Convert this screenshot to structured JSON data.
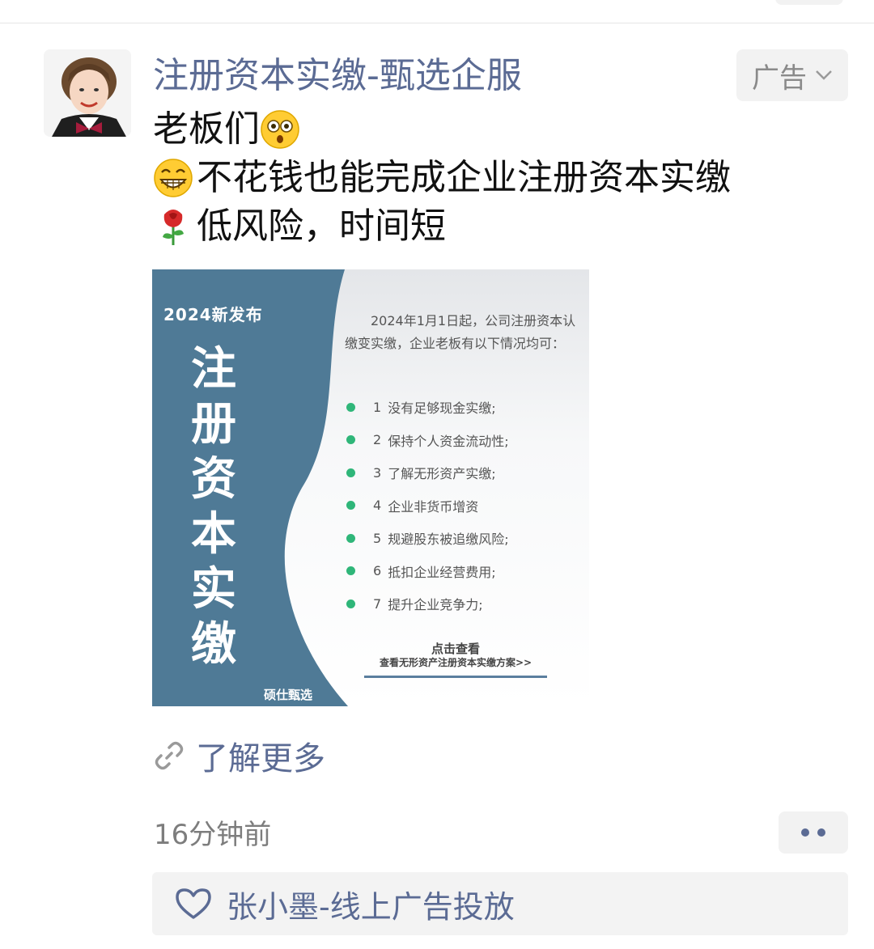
{
  "post": {
    "author_name": "注册资本实缴-甄选企服",
    "ad_label": "广告",
    "lines": [
      "老板们",
      "不花钱也能完成企业注册资本实缴",
      "低风险，时间短"
    ],
    "learn_more": "了解更多",
    "timestamp": "16分钟前",
    "likes_name": "张小墨-线上广告投放"
  },
  "ad_image": {
    "release_label": "2024新发布",
    "title": "注册资本实缴",
    "brand": "硕仕甄选",
    "intro": "2024年1月1日起，公司注册资本认缴变实缴，企业老板有以下情况均可：",
    "items": [
      {
        "num": "1",
        "text": "没有足够现金实缴;"
      },
      {
        "num": "2",
        "text": "保持个人资金流动性;"
      },
      {
        "num": "3",
        "text": "了解无形资产实缴;"
      },
      {
        "num": "4",
        "text": "企业非货币增资"
      },
      {
        "num": "5",
        "text": "规避股东被追缴风险;"
      },
      {
        "num": "6",
        "text": "抵扣企业经营费用;"
      },
      {
        "num": "7",
        "text": "提升企业竞争力;"
      }
    ],
    "cta_main": "点击查看",
    "cta_sub": "查看无形资产注册资本实缴方案>>"
  },
  "colors": {
    "link_blue": "#5b6b94",
    "ad_panel_blue": "#4f7a96",
    "bullet_green": "#2fb679",
    "meta_gray": "#7d7d7d"
  }
}
